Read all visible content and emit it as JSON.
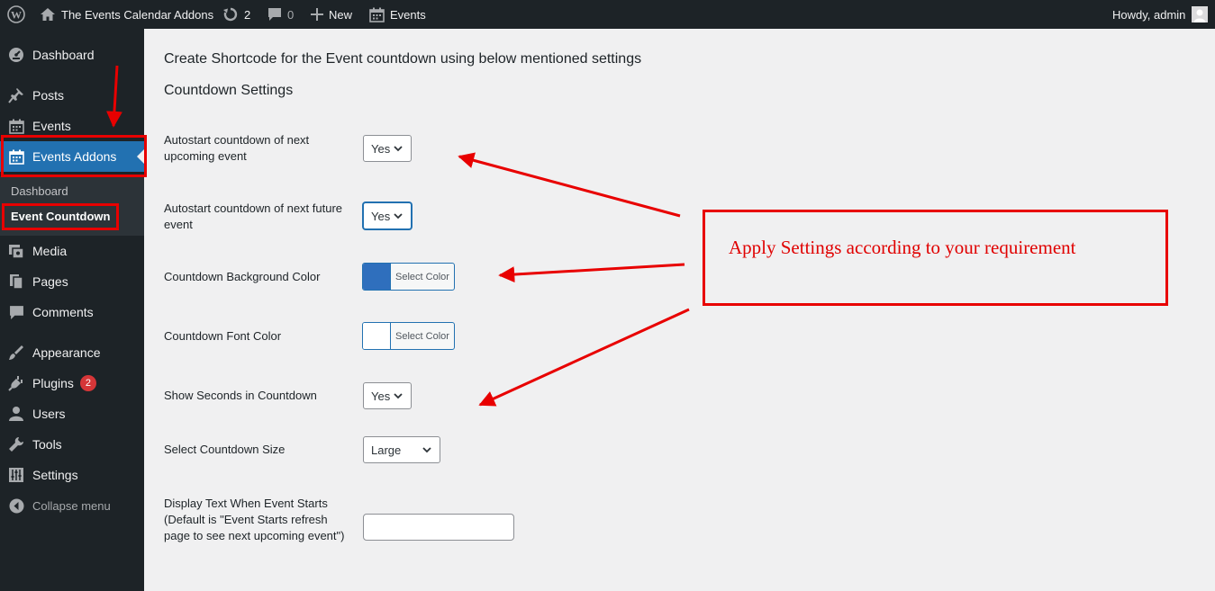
{
  "adminbar": {
    "wp_logo_icon": "wordpress-icon",
    "site_name": "The Events Calendar Addons",
    "updates_count": "2",
    "comments_count": "0",
    "new_label": "New",
    "events_label": "Events",
    "greeting": "Howdy, admin"
  },
  "sidebar": {
    "items": [
      {
        "label": "Dashboard",
        "icon": "dashboard-icon"
      },
      {
        "label": "Posts",
        "icon": "pin-icon"
      },
      {
        "label": "Events",
        "icon": "calendar-icon"
      },
      {
        "label": "Events Addons",
        "icon": "calendar-icon"
      },
      {
        "label": "Media",
        "icon": "media-icon"
      },
      {
        "label": "Pages",
        "icon": "pages-icon"
      },
      {
        "label": "Comments",
        "icon": "comment-icon"
      },
      {
        "label": "Appearance",
        "icon": "brush-icon"
      },
      {
        "label": "Plugins",
        "icon": "plugin-icon",
        "badge": "2"
      },
      {
        "label": "Users",
        "icon": "users-icon"
      },
      {
        "label": "Tools",
        "icon": "wrench-icon"
      },
      {
        "label": "Settings",
        "icon": "settings-icon"
      },
      {
        "label": "Collapse menu",
        "icon": "collapse-icon"
      }
    ],
    "submenu": [
      {
        "label": "Dashboard"
      },
      {
        "label": "Event Countdown"
      }
    ]
  },
  "main": {
    "title": "Create Shortcode for the Event countdown using below mentioned settings",
    "section_title": "Countdown Settings",
    "fields": {
      "autostart_next": {
        "label": "Autostart countdown of next upcoming event",
        "value": "Yes"
      },
      "autostart_future": {
        "label": "Autostart countdown of next future event",
        "value": "Yes"
      },
      "bg_color": {
        "label": "Countdown Background Color",
        "button": "Select Color",
        "color": "#2f6fbd"
      },
      "font_color": {
        "label": "Countdown Font Color",
        "button": "Select Color",
        "color": "#ffffff"
      },
      "show_seconds": {
        "label": "Show Seconds in Countdown",
        "value": "Yes"
      },
      "size": {
        "label": "Select Countdown Size",
        "value": "Large"
      },
      "display_text": {
        "label": "Display Text When Event Starts (Default is \"Event Starts refresh page to see next upcoming event\")",
        "value": ""
      }
    }
  },
  "annotation": {
    "callout_text": "Apply Settings according to your requirement",
    "color": "#e80000"
  },
  "colors": {
    "adminbar_bg": "#1d2327",
    "sidebar_bg": "#1d2327",
    "accent": "#2271b1",
    "annotation": "#e80000"
  }
}
